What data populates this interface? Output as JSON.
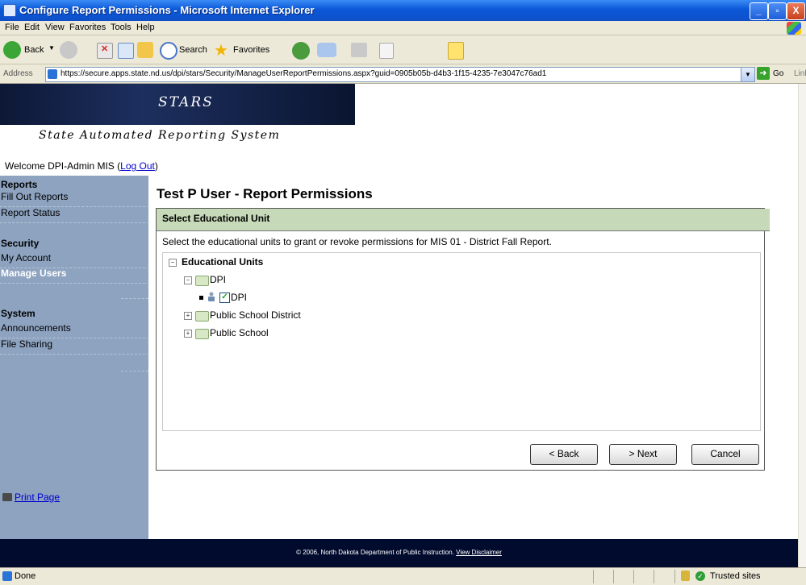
{
  "window": {
    "title": "Configure Report Permissions - Microsoft Internet Explorer",
    "minimize": "_",
    "maximize": "▫",
    "close": "X"
  },
  "menu": [
    "File",
    "Edit",
    "View",
    "Favorites",
    "Tools",
    "Help"
  ],
  "toolbar": {
    "back_label": "Back",
    "search_label": "Search",
    "favorites_label": "Favorites"
  },
  "address": {
    "label": "Address",
    "url": "https://secure.apps.state.nd.us/dpi/stars/Security/ManageUserReportPermissions.aspx?guid=0905b05b-d4b3-1f15-4235-7e3047c76ad1",
    "go_label": "Go",
    "links_label": "Link"
  },
  "banner": {
    "title": "STARS",
    "subtitle": "State Automated Reporting System"
  },
  "welcome": {
    "text": "Welcome DPI-Admin MIS (",
    "logout": "Log Out",
    "close_paren": ")"
  },
  "sidebar": {
    "reports_heading": "Reports",
    "fill_out_reports": "Fill Out Reports",
    "report_status": "Report Status",
    "security_heading": "Security",
    "my_account": "My Account",
    "manage_users": "Manage Users",
    "system_heading": "System",
    "announcements": "Announcements",
    "file_sharing": "File Sharing",
    "print_page": "Print Page"
  },
  "main": {
    "title": "Test P User - Report Permissions",
    "panel_title": "Select Educational Unit",
    "description": "Select the educational units to grant or revoke permissions for MIS 01 - District Fall Report.",
    "tree": {
      "root": "Educational Units",
      "dpi": "DPI",
      "dpi_child": "DPI",
      "dpi_child_checked": true,
      "public_school_district": "Public School District",
      "public_school": "Public School"
    },
    "buttons": {
      "back": "< Back",
      "next": "> Next",
      "cancel": "Cancel"
    }
  },
  "footer": {
    "text": "© 2006, North Dakota Department of Public Instruction.",
    "disclaimer": "View Disclaimer"
  },
  "status": {
    "done": "Done",
    "zone": "Trusted sites"
  }
}
